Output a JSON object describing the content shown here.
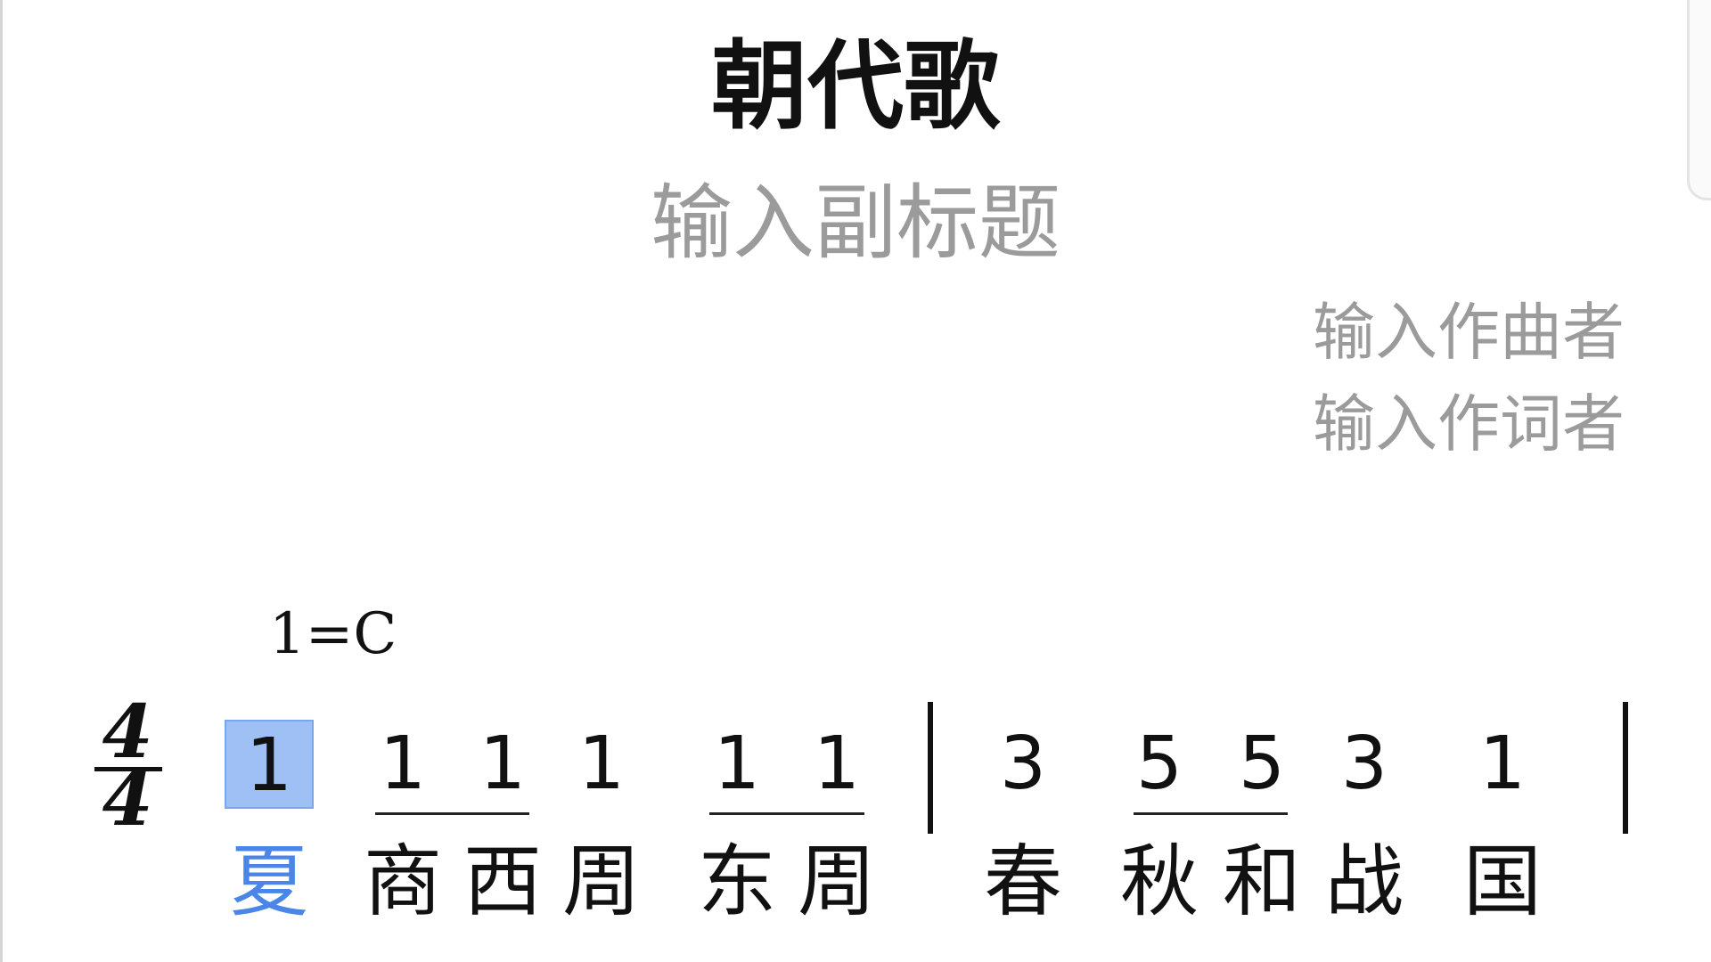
{
  "score": {
    "title": "朝代歌",
    "subtitle_placeholder": "输入副标题",
    "composer_placeholder": "输入作曲者",
    "lyricist_placeholder": "输入作词者",
    "key_signature": "1=C",
    "time_signature": {
      "top": "4",
      "bottom": "4"
    },
    "measures": [
      {
        "notes": [
          {
            "digit": "1",
            "lyric": "夏",
            "selected": true
          },
          {
            "digit": "1",
            "lyric": "商"
          },
          {
            "digit": "1",
            "lyric": "西"
          },
          {
            "digit": "1",
            "lyric": "周"
          },
          {
            "digit": "1",
            "lyric": "东"
          },
          {
            "digit": "1",
            "lyric": "周"
          }
        ]
      },
      {
        "notes": [
          {
            "digit": "3",
            "lyric": "春"
          },
          {
            "digit": "5",
            "lyric": "秋"
          },
          {
            "digit": "5",
            "lyric": "和"
          },
          {
            "digit": "3",
            "lyric": "战"
          },
          {
            "digit": "1",
            "lyric": "国"
          }
        ]
      }
    ]
  },
  "colors": {
    "selection_fill": "#9fc0f4",
    "selected_lyric": "#4a86e8",
    "placeholder_text": "#9b9b9b"
  }
}
